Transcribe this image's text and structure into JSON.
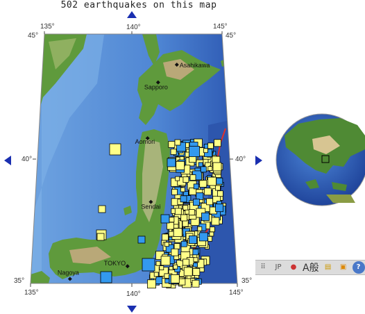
{
  "title": "502 earthquakes on this map",
  "map": {
    "lon_ticks_top": [
      "135°",
      "140°",
      "145°"
    ],
    "lon_ticks_bottom": [
      "135°",
      "140°",
      "145°"
    ],
    "lat_ticks_left": [
      "45°",
      "40°",
      "35°"
    ],
    "lat_ticks_right": [
      "45°",
      "40°",
      "35°"
    ],
    "cities": [
      {
        "name": "Asahikawa",
        "lon": 142.4,
        "lat": 43.77
      },
      {
        "name": "Sapporo",
        "lon": 141.35,
        "lat": 43.06
      },
      {
        "name": "Aomori",
        "lon": 140.74,
        "lat": 40.82
      },
      {
        "name": "Sendai",
        "lon": 140.87,
        "lat": 38.27
      },
      {
        "name": "TOKYO",
        "lon": 139.69,
        "lat": 35.69
      },
      {
        "name": "Nagoya",
        "lon": 136.9,
        "lat": 35.18
      }
    ],
    "colors": {
      "ocean_deep": "#2f5fbf",
      "ocean_shallow": "#7fb0e8",
      "land": "#5f9a3c",
      "mountain": "#c8b890",
      "quake_yellow": "#ffff88",
      "quake_blue": "#3399ee",
      "plate_boundary": "#e0302a"
    }
  },
  "nav": {
    "up_icon": "triangle-up-icon",
    "down_icon": "triangle-down-icon",
    "left_icon": "triangle-left-icon",
    "right_icon": "triangle-right-icon"
  },
  "globe": {
    "icon": "globe-icon"
  },
  "language_bar": {
    "label": "JP",
    "chars": "A般",
    "help": "?"
  }
}
